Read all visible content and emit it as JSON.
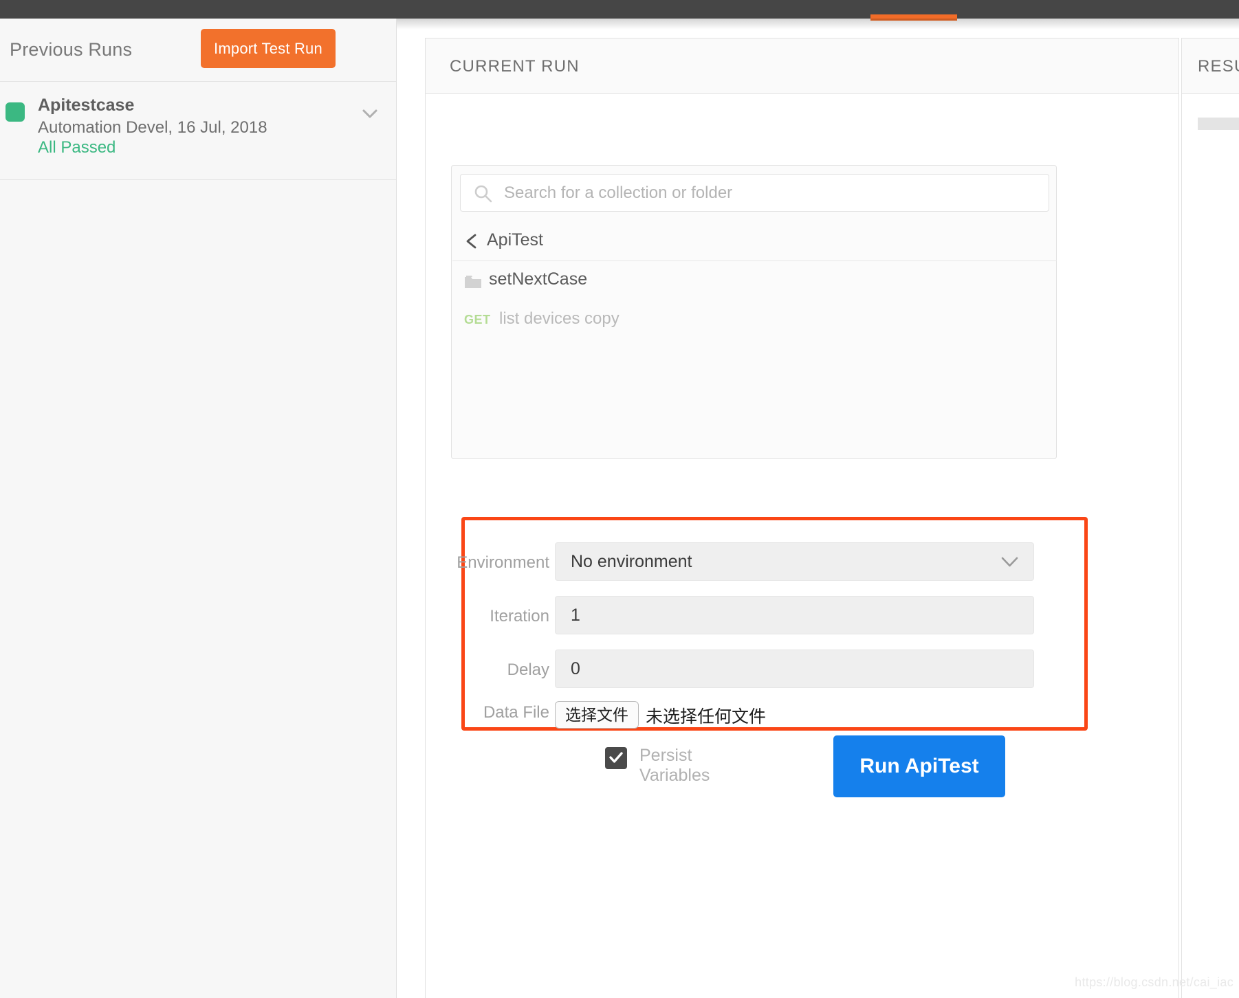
{
  "topbar": {
    "active_tab_indicator_color": "#f26c28"
  },
  "sidebar": {
    "title": "Previous Runs",
    "import_button_label": "Import Test Run",
    "runs": [
      {
        "name": "Apitestcase",
        "meta": "Automation Devel, 16 Jul, 2018",
        "result": "All Passed",
        "status_color": "#3bb882",
        "chevron_icon": "chevron-down-icon"
      }
    ]
  },
  "main": {
    "header_title": "CURRENT RUN",
    "search": {
      "placeholder": "Search for a collection or folder",
      "value": "",
      "icon": "search-icon"
    },
    "breadcrumb": {
      "back_icon": "chevron-left-icon",
      "label": "ApiTest"
    },
    "items": [
      {
        "type": "folder",
        "icon": "folder-icon",
        "label": "setNextCase"
      },
      {
        "type": "request",
        "method": "GET",
        "label": "list devices copy"
      }
    ],
    "settings": {
      "highlight_color": "#fa4616",
      "environment": {
        "label": "Environment",
        "value": "No environment",
        "chevron_icon": "chevron-down-icon"
      },
      "iteration": {
        "label": "Iteration",
        "value": "1"
      },
      "delay": {
        "label": "Delay",
        "value": "0"
      },
      "data_file": {
        "label": "Data File",
        "button_label": "选择文件",
        "status": "未选择任何文件"
      }
    },
    "persist_variables": {
      "label": "Persist Variables",
      "checked": true,
      "check_icon": "checkmark-icon"
    },
    "run_button_label": "Run ApiTest"
  },
  "results": {
    "header_title": "RESULTS"
  },
  "watermark": "https://blog.csdn.net/cai_iac"
}
